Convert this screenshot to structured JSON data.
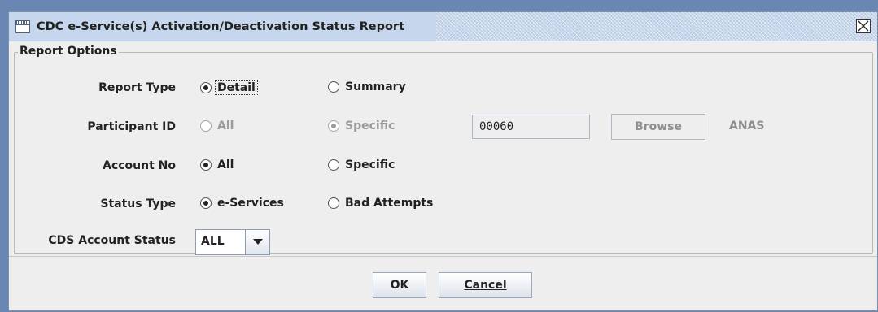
{
  "window": {
    "title": "CDC e-Service(s) Activation/Deactivation Status Report",
    "close_icon": "close-x-icon",
    "app_icon": "window-icon"
  },
  "report_options": {
    "legend": "Report Options",
    "report_type": {
      "label": "Report Type",
      "options": [
        "Detail",
        "Summary"
      ],
      "selected": "Detail"
    },
    "participant_id": {
      "label": "Participant ID",
      "options": [
        "All",
        "Specific"
      ],
      "selected": "Specific",
      "enabled": false,
      "value": "00060",
      "browse_label": "Browse",
      "code": "ANAS"
    },
    "account_no": {
      "label": "Account No",
      "options": [
        "All",
        "Specific"
      ],
      "selected": "All"
    },
    "status_type": {
      "label": "Status Type",
      "options": [
        "e-Services",
        "Bad Attempts"
      ],
      "selected": "e-Services"
    },
    "cds_account_status": {
      "label": "CDS Account Status",
      "selected": "ALL"
    }
  },
  "footer": {
    "ok_label": "OK",
    "cancel_label": "Cancel"
  },
  "colors": {
    "background": "#6a87b3",
    "window": "#eeeeee",
    "titlebar": "#c6d6ec",
    "disabled_text": "#9a9a9a"
  }
}
